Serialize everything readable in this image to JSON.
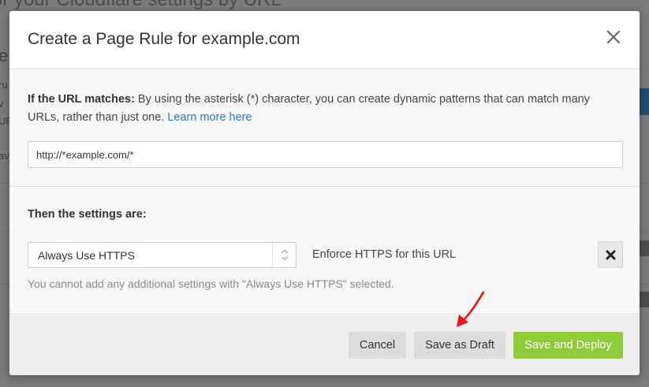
{
  "background": {
    "heading_fragment": "or your Cloudflare settings by URL",
    "side_fragments": [
      "e",
      "ru",
      "v",
      "UR",
      "av"
    ]
  },
  "modal": {
    "title": "Create a Page Rule for example.com",
    "close_icon": "close-icon",
    "url_section": {
      "label": "If the URL matches:",
      "description": " By using the asterisk (*) character, you can create dynamic patterns that can match many URLs, rather than just one. ",
      "learn_more": "Learn more here",
      "input_value": "http://*example.com/*"
    },
    "settings_section": {
      "title": "Then the settings are:",
      "selected_setting": "Always Use HTTPS",
      "setting_description": "Enforce HTTPS for this URL",
      "remove_icon": "x-icon",
      "note": "You cannot add any additional settings with \"Always Use HTTPS\" selected."
    },
    "footer": {
      "cancel": "Cancel",
      "save_draft": "Save as Draft",
      "save_deploy": "Save and Deploy"
    }
  },
  "colors": {
    "link": "#2f7bbf",
    "deploy_button": "#8fcb39",
    "annotation_arrow": "#e0161c"
  }
}
